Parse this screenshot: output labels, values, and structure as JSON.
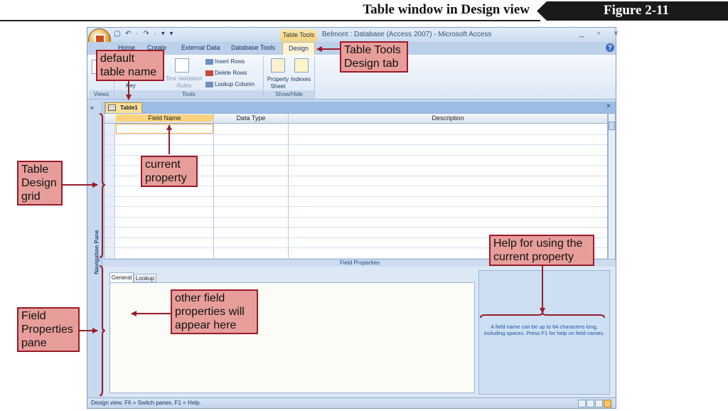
{
  "figure": {
    "title": "Table window in Design view",
    "label": "Figure 2-11"
  },
  "window": {
    "title": "Belmont : Database (Access 2007) - Microsoft Access",
    "context_tab_group": "Table Tools",
    "quick_access": "▢ ↶ · ↷ · ▾ ▾",
    "controls": "_ ▫ ×"
  },
  "ribbon": {
    "tabs": [
      "Home",
      "Create",
      "External Data",
      "Database Tools",
      "Design"
    ],
    "active_tab": "Design",
    "groups": [
      {
        "label": "Views"
      },
      {
        "label": "Tools"
      },
      {
        "label": "Show/Hide"
      }
    ],
    "buttons": {
      "key": "Key",
      "test_validation_rules": "Test Validation Rules",
      "insert_rows": "Insert Rows",
      "delete_rows": "Delete Rows",
      "lookup_column": "Lookup Column",
      "property_sheet": "Property Sheet",
      "indexes": "Indexes"
    }
  },
  "navigation_pane": {
    "label": "Navigation Pane",
    "toggle": "»"
  },
  "document": {
    "tab": "Table1",
    "close": "×"
  },
  "grid": {
    "columns": [
      "Field Name",
      "Data Type",
      "Description"
    ],
    "row_count": 13
  },
  "field_properties": {
    "title": "Field Properties",
    "tabs": [
      "General",
      "Lookup"
    ],
    "help_text": "A field name can be up to 64 characters long, including spaces.  Press F1 for help on field names."
  },
  "status_bar": {
    "text": "Design view.  F6 = Switch panes.  F1 = Help."
  },
  "callouts": {
    "default_table_name": "default table name",
    "table_tools_design_tab": "Table Tools Design tab",
    "current_property": "current property",
    "table_design_grid": "Table Design grid",
    "help_current_property": "Help for using the current property",
    "other_field_properties": "other field properties will appear here",
    "field_properties_pane": "Field Properties pane"
  },
  "colors": {
    "callout_fill": "#e79e9a",
    "callout_border": "#9a1b2a",
    "ribbon_active_tab": "#fdf3d6",
    "selected_column_header": "#fbd37c"
  }
}
